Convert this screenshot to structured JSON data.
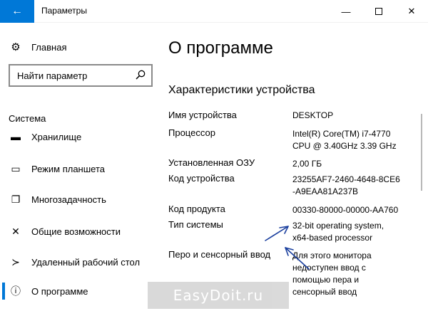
{
  "window": {
    "title": "Параметры",
    "back_icon": "←",
    "min_icon": "—",
    "close_icon": "✕"
  },
  "sidebar": {
    "home": {
      "label": "Главная",
      "icon": "gear-icon",
      "glyph": "⚙"
    },
    "search": {
      "placeholder": "Найти параметр",
      "icon": "search-icon"
    },
    "section": "Система",
    "items": [
      {
        "label": "Хранилище",
        "icon": "storage-icon",
        "glyph": "▬"
      },
      {
        "label": "Режим планшета",
        "icon": "tablet-mode-icon",
        "glyph": "▭"
      },
      {
        "label": "Многозадачность",
        "icon": "multitasking-icon",
        "glyph": "❐"
      },
      {
        "label": "Общие возможности",
        "icon": "shared-experiences-icon",
        "glyph": "✕"
      },
      {
        "label": "Удаленный рабочий стол",
        "icon": "remote-desktop-icon",
        "glyph": "≻"
      },
      {
        "label": "О программе",
        "icon": "info-icon",
        "glyph": "ⓘ",
        "active": true
      }
    ]
  },
  "main": {
    "title": "О программе",
    "section_title": "Характеристики устройства",
    "specs": [
      {
        "label": "Имя устройства",
        "value": "DESKTOP"
      },
      {
        "label": "Процессор",
        "value": "Intel(R) Core(TM) i7-4770\nCPU @ 3.40GHz   3.39 GHz"
      },
      {
        "label": "Установленная ОЗУ",
        "value": "2,00 ГБ"
      },
      {
        "label": "Код устройства",
        "value": "23255AF7-2460-4648-8CE6\n-A9EAA81A237B"
      },
      {
        "label": "Код продукта",
        "value": "00330-80000-00000-AA760"
      },
      {
        "label": "Тип системы",
        "value": "32-bit operating system,\nx64-based processor"
      },
      {
        "label": "Перо и сенсорный ввод",
        "value": "Для этого монитора\nнедоступен ввод с\nпомощью пера и\nсенсорный ввод"
      }
    ]
  },
  "watermark": "EasyDoit.ru",
  "annotation_color": "#1a3f9e",
  "accent_color": "#0078d7"
}
